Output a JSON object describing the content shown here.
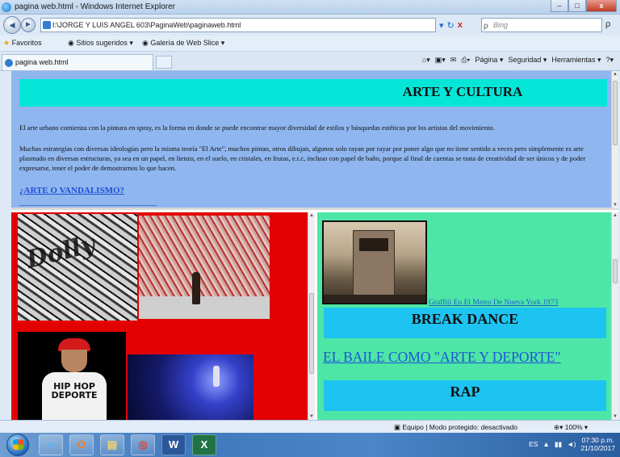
{
  "window": {
    "title": "pagina web.html - Windows Internet Explorer",
    "minimize": "–",
    "maximize": "□",
    "close": "x"
  },
  "address": {
    "back": "◄",
    "forward": "►",
    "url": "I:\\JORGE Y LUIS ANGEL 603\\PaginaWeb\\paginaweb.html",
    "refresh": "↻",
    "stop": "x",
    "search_placeholder": "Bing",
    "search_go": "ρ"
  },
  "favorites": {
    "label": "Favoritos",
    "suggested": "Sitios sugeridos ▾",
    "gallery": "Galería de Web Slice ▾"
  },
  "tab": {
    "title": "pagina web.html"
  },
  "command_bar": {
    "items": [
      "Página ▾",
      "Seguridad ▾",
      "Herramientas ▾"
    ]
  },
  "page": {
    "heading": "ARTE Y CULTURA",
    "paragraph1": "El arte urbano comienza con la pintura en spray, es la forma en donde se puede encontrar mayor diversidad de estilos y búsquedas estéticas por los artistas del movimiento.",
    "paragraph2": "Muchas estrategias con diversas ideologías pero la misma teoría \"El Arte\", muchos pintan, otros dibujan, algunos solo rayan por rayar por poner algo que no tiene sentido a veces pero simplemente es arte plasmado en diversas estructuras, ya sea en un papel, en lienzo, en el suelo, en cristales, en frutas, e.t.c, incluso con papel de baño, porque al final de cuentas se trata de creatividad de ser únicos y de poder expresarse, tener el poder de demostrarnos lo que hacen.",
    "link": "¿ARTE O VANDALISMO?",
    "graffiti_tag": "Dolly",
    "shirt_text": "HIP HOP DEPORTE",
    "caption_subway": "Graffiti En El Metro De Nueva York 1973",
    "section_break": "BREAK DANCE",
    "link_baile": "EL BAILE COMO \"ARTE Y DEPORTE\"",
    "section_rap": "RAP"
  },
  "status": {
    "zone": "Equipo | Modo protegido: desactivado",
    "zoom": "100%"
  },
  "taskbar": {
    "apps": [
      "e",
      "O",
      "▤",
      "◎",
      "W",
      "X"
    ],
    "lang": "ES",
    "time": "07:30 p.m.",
    "date": "21/10/2017"
  },
  "colors": {
    "top_frame": "#8fb6ee",
    "heading_bar": "#05e6d8",
    "left_frame": "#e20000",
    "right_frame": "#4de6a6",
    "section_bar": "#1dc4f2",
    "link": "#1f4fd6"
  }
}
